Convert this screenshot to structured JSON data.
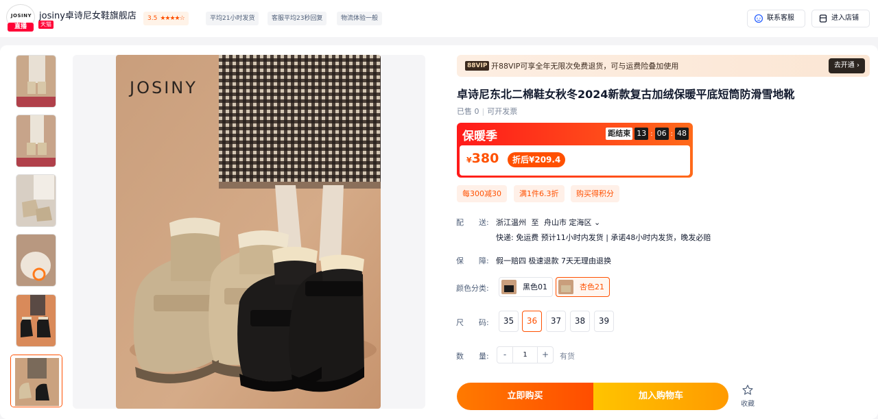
{
  "store": {
    "logo_text": "JOSINY",
    "live_badge": "直播",
    "name": "josiny卓诗尼女鞋旗舰店",
    "tmall_badge": "天猫",
    "rating": "3.5",
    "rating_stars": 3.5,
    "tags": [
      "平均21小时发货",
      "客服平均23秒回复",
      "物流体验一般"
    ],
    "contact_button": "联系客服",
    "enter_store_button": "进入店铺"
  },
  "gallery": {
    "brand_text": "JOSINY",
    "thumbnails": [
      "thumb-1",
      "thumb-2",
      "thumb-3",
      "thumb-4",
      "thumb-5",
      "thumb-6"
    ],
    "active_index": 5
  },
  "vip": {
    "tag": "88VIP",
    "text": "开88VIP可享全年无限次免费退货，可与运费险叠加使用",
    "button": "去开通"
  },
  "product": {
    "title": "卓诗尼东北二棉鞋女秋冬2024新款复古加绒保暖平底短筒防滑雪地靴",
    "sold": "已售 0",
    "invoice": "可开发票"
  },
  "price": {
    "campaign": "保暖季",
    "countdown_label": "距结束",
    "countdown": [
      "13",
      "06",
      "48"
    ],
    "currency": "¥",
    "value": "380",
    "discount": "折后¥209.4"
  },
  "promos": [
    "每300减30",
    "满1件6.3折",
    "购买得积分"
  ],
  "delivery": {
    "label": "配　　送:",
    "from": "浙江温州",
    "to_word": "至",
    "to": "舟山市 定海区",
    "line2": "快递: 免运费   预计11小时内发货 | 承诺48小时内发货，晚发必赔"
  },
  "guarantee": {
    "label": "保　　障:",
    "text": "假一赔四 极速退款 7天无理由退换"
  },
  "colors": {
    "label": "颜色分类:",
    "options": [
      "黑色01",
      "杏色21"
    ],
    "selected": "杏色21"
  },
  "sizes": {
    "label": "尺　　码:",
    "options": [
      "35",
      "36",
      "37",
      "38",
      "39"
    ],
    "selected": "36"
  },
  "quantity": {
    "label": "数　　量:",
    "minus": "-",
    "value": "1",
    "plus": "+",
    "stock": "有货"
  },
  "actions": {
    "buy": "立即购买",
    "cart": "加入购物车",
    "favorite": "收藏"
  },
  "colors_theme": {
    "accent": "#ff5000",
    "live_red": "#ff0036"
  }
}
